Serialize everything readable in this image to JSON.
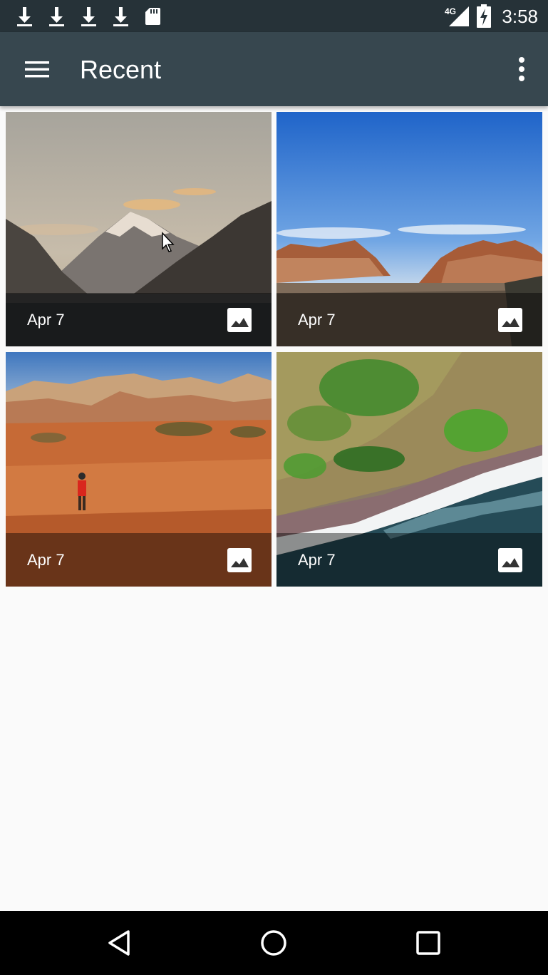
{
  "status_bar": {
    "left_icons": [
      "download-icon",
      "download-icon",
      "download-icon",
      "download-icon",
      "sd-card-icon"
    ],
    "network": "4G",
    "time": "3:58"
  },
  "app_bar": {
    "title": "Recent",
    "menu_icon": "hamburger-menu-icon",
    "overflow_icon": "more-vert-icon"
  },
  "files": [
    {
      "date": "Apr 7",
      "type_icon": "image-icon",
      "subject": "snowy mountain peak over lake at sunset"
    },
    {
      "date": "Apr 7",
      "type_icon": "image-icon",
      "subject": "red rock canyon under blue sky"
    },
    {
      "date": "Apr 7",
      "type_icon": "image-icon",
      "subject": "hiker in red sandstone desert"
    },
    {
      "date": "Apr 7",
      "type_icon": "image-icon",
      "subject": "aerial coastline with green cliffs and surf"
    }
  ],
  "nav_bar": {
    "buttons": [
      "back-icon",
      "home-icon",
      "recents-icon"
    ]
  }
}
